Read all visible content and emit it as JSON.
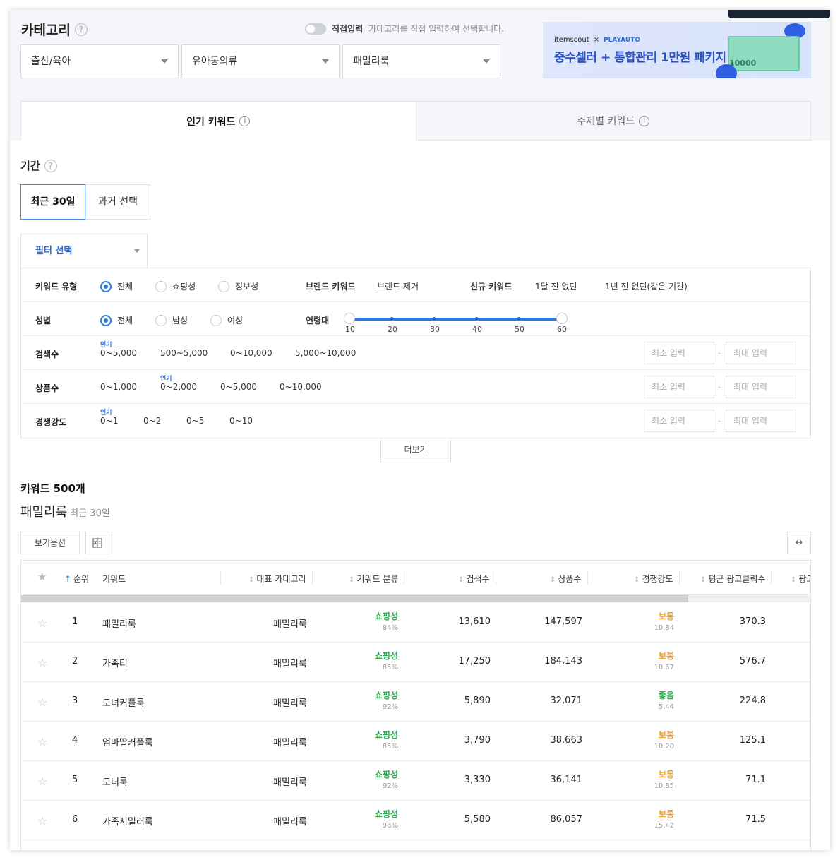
{
  "category": {
    "title": "카테고리",
    "help": "?",
    "toggle_label": "직접입력",
    "toggle_desc": "카테고리를 직접 입력하여 선택합니다.",
    "selects": [
      "출산/육아",
      "유아동의류",
      "패밀리룩"
    ]
  },
  "banner": {
    "brand1": "itemscout",
    "x": "×",
    "brand2": "PLAYAUTO",
    "text": "중수셀러 + 통합관리 1만원 패키지",
    "bill_value": "10000"
  },
  "tabs": [
    {
      "label": "인기 키워드",
      "info": "i"
    },
    {
      "label": "주제별 키워드",
      "info": "i"
    }
  ],
  "period": {
    "title": "기간",
    "help": "?",
    "buttons": [
      "최근 30일",
      "과거 선택"
    ]
  },
  "filter": {
    "select_label": "필터 선택",
    "keyword_type": {
      "label": "키워드 유형",
      "options": [
        "전체",
        "쇼핑성",
        "정보성"
      ],
      "selected": "전체"
    },
    "brand": {
      "label": "브랜드 키워드",
      "option": "브랜드 제거"
    },
    "new_kw": {
      "label": "신규 키워드",
      "options": [
        "1달 전 없던",
        "1년 전 없던(같은 기간)"
      ]
    },
    "gender": {
      "label": "성별",
      "options": [
        "전체",
        "남성",
        "여성"
      ],
      "selected": "전체"
    },
    "age": {
      "label": "연령대",
      "ticks": [
        "10",
        "20",
        "30",
        "40",
        "50",
        "60"
      ],
      "range": [
        10,
        60
      ]
    },
    "search_count": {
      "label": "검색수",
      "options": [
        "0~5,000",
        "500~5,000",
        "0~10,000",
        "5,000~10,000"
      ],
      "popular": "인기"
    },
    "product_count": {
      "label": "상품수",
      "options": [
        "0~1,000",
        "0~2,000",
        "0~5,000",
        "0~10,000"
      ],
      "popular": "인기"
    },
    "competition": {
      "label": "경쟁강도",
      "options": [
        "0~1",
        "0~2",
        "0~5",
        "0~10"
      ],
      "popular": "인기"
    },
    "min_placeholder": "최소 입력",
    "max_placeholder": "최대 입력",
    "dash": "-"
  },
  "more_button": "더보기",
  "keywords": {
    "count_title": "키워드 500개",
    "subtitle": "패밀리룩",
    "subtitle_period": "최근 30일",
    "view_options": "보기옵션",
    "expand": "↔"
  },
  "table": {
    "headers": [
      "순위",
      "키워드",
      "대표 카테고리",
      "키워드 분류",
      "검색수",
      "상품수",
      "경쟁강도",
      "평균 광고클릭수",
      "광고"
    ],
    "rows": [
      {
        "rank": "1",
        "keyword": "패밀리룩",
        "category": "패밀리룩",
        "type": "쇼핑성",
        "type_pct": "84%",
        "search": "13,610",
        "products": "147,597",
        "comp": "보통",
        "comp_val": "10.84",
        "clicks": "370.3"
      },
      {
        "rank": "2",
        "keyword": "가족티",
        "category": "패밀리룩",
        "type": "쇼핑성",
        "type_pct": "85%",
        "search": "17,250",
        "products": "184,143",
        "comp": "보통",
        "comp_val": "10.67",
        "clicks": "576.7"
      },
      {
        "rank": "3",
        "keyword": "모녀커플룩",
        "category": "패밀리룩",
        "type": "쇼핑성",
        "type_pct": "92%",
        "search": "5,890",
        "products": "32,071",
        "comp": "좋음",
        "comp_val": "5.44",
        "clicks": "224.8"
      },
      {
        "rank": "4",
        "keyword": "엄마딸커플룩",
        "category": "패밀리룩",
        "type": "쇼핑성",
        "type_pct": "85%",
        "search": "3,790",
        "products": "38,663",
        "comp": "보통",
        "comp_val": "10.20",
        "clicks": "125.1"
      },
      {
        "rank": "5",
        "keyword": "모녀룩",
        "category": "패밀리룩",
        "type": "쇼핑성",
        "type_pct": "92%",
        "search": "3,330",
        "products": "36,141",
        "comp": "보통",
        "comp_val": "10.85",
        "clicks": "71.1"
      },
      {
        "rank": "6",
        "keyword": "가족시밀러룩",
        "category": "패밀리룩",
        "type": "쇼핑성",
        "type_pct": "96%",
        "search": "5,580",
        "products": "86,057",
        "comp": "보통",
        "comp_val": "15.42",
        "clicks": "71.5"
      }
    ]
  },
  "colors": {
    "accent": "#2a7be0",
    "green": "#2ea84d",
    "orange": "#f0a020",
    "banner_text": "#2a53c6"
  }
}
